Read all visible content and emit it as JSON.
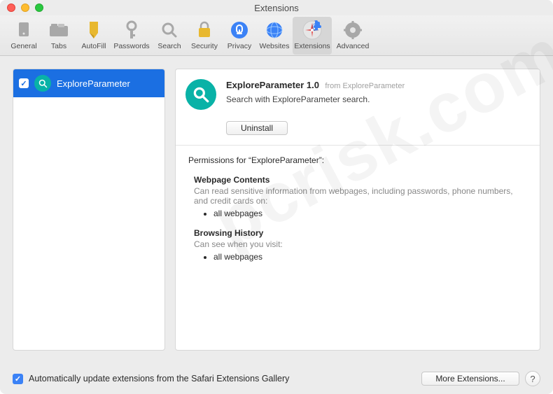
{
  "window": {
    "title": "Extensions"
  },
  "toolbar": {
    "items": [
      {
        "label": "General"
      },
      {
        "label": "Tabs"
      },
      {
        "label": "AutoFill"
      },
      {
        "label": "Passwords"
      },
      {
        "label": "Search"
      },
      {
        "label": "Security"
      },
      {
        "label": "Privacy"
      },
      {
        "label": "Websites"
      },
      {
        "label": "Extensions"
      },
      {
        "label": "Advanced"
      }
    ]
  },
  "sidebar": {
    "items": [
      {
        "name": "ExploreParameter",
        "enabled": true
      }
    ]
  },
  "detail": {
    "title": "ExploreParameter 1.0",
    "from_prefix": "from",
    "from_name": "ExploreParameter",
    "description": "Search with ExploreParameter search.",
    "uninstall_label": "Uninstall",
    "permissions_title": "Permissions for “ExploreParameter”:",
    "perm1_head": "Webpage Contents",
    "perm1_sub": "Can read sensitive information from webpages, including passwords, phone numbers, and credit cards on:",
    "perm1_item": "all webpages",
    "perm2_head": "Browsing History",
    "perm2_sub": "Can see when you visit:",
    "perm2_item": "all webpages"
  },
  "footer": {
    "auto_update_label": "Automatically update extensions from the Safari Extensions Gallery",
    "more_label": "More Extensions...",
    "help": "?"
  },
  "watermark": "pcrisk.com"
}
